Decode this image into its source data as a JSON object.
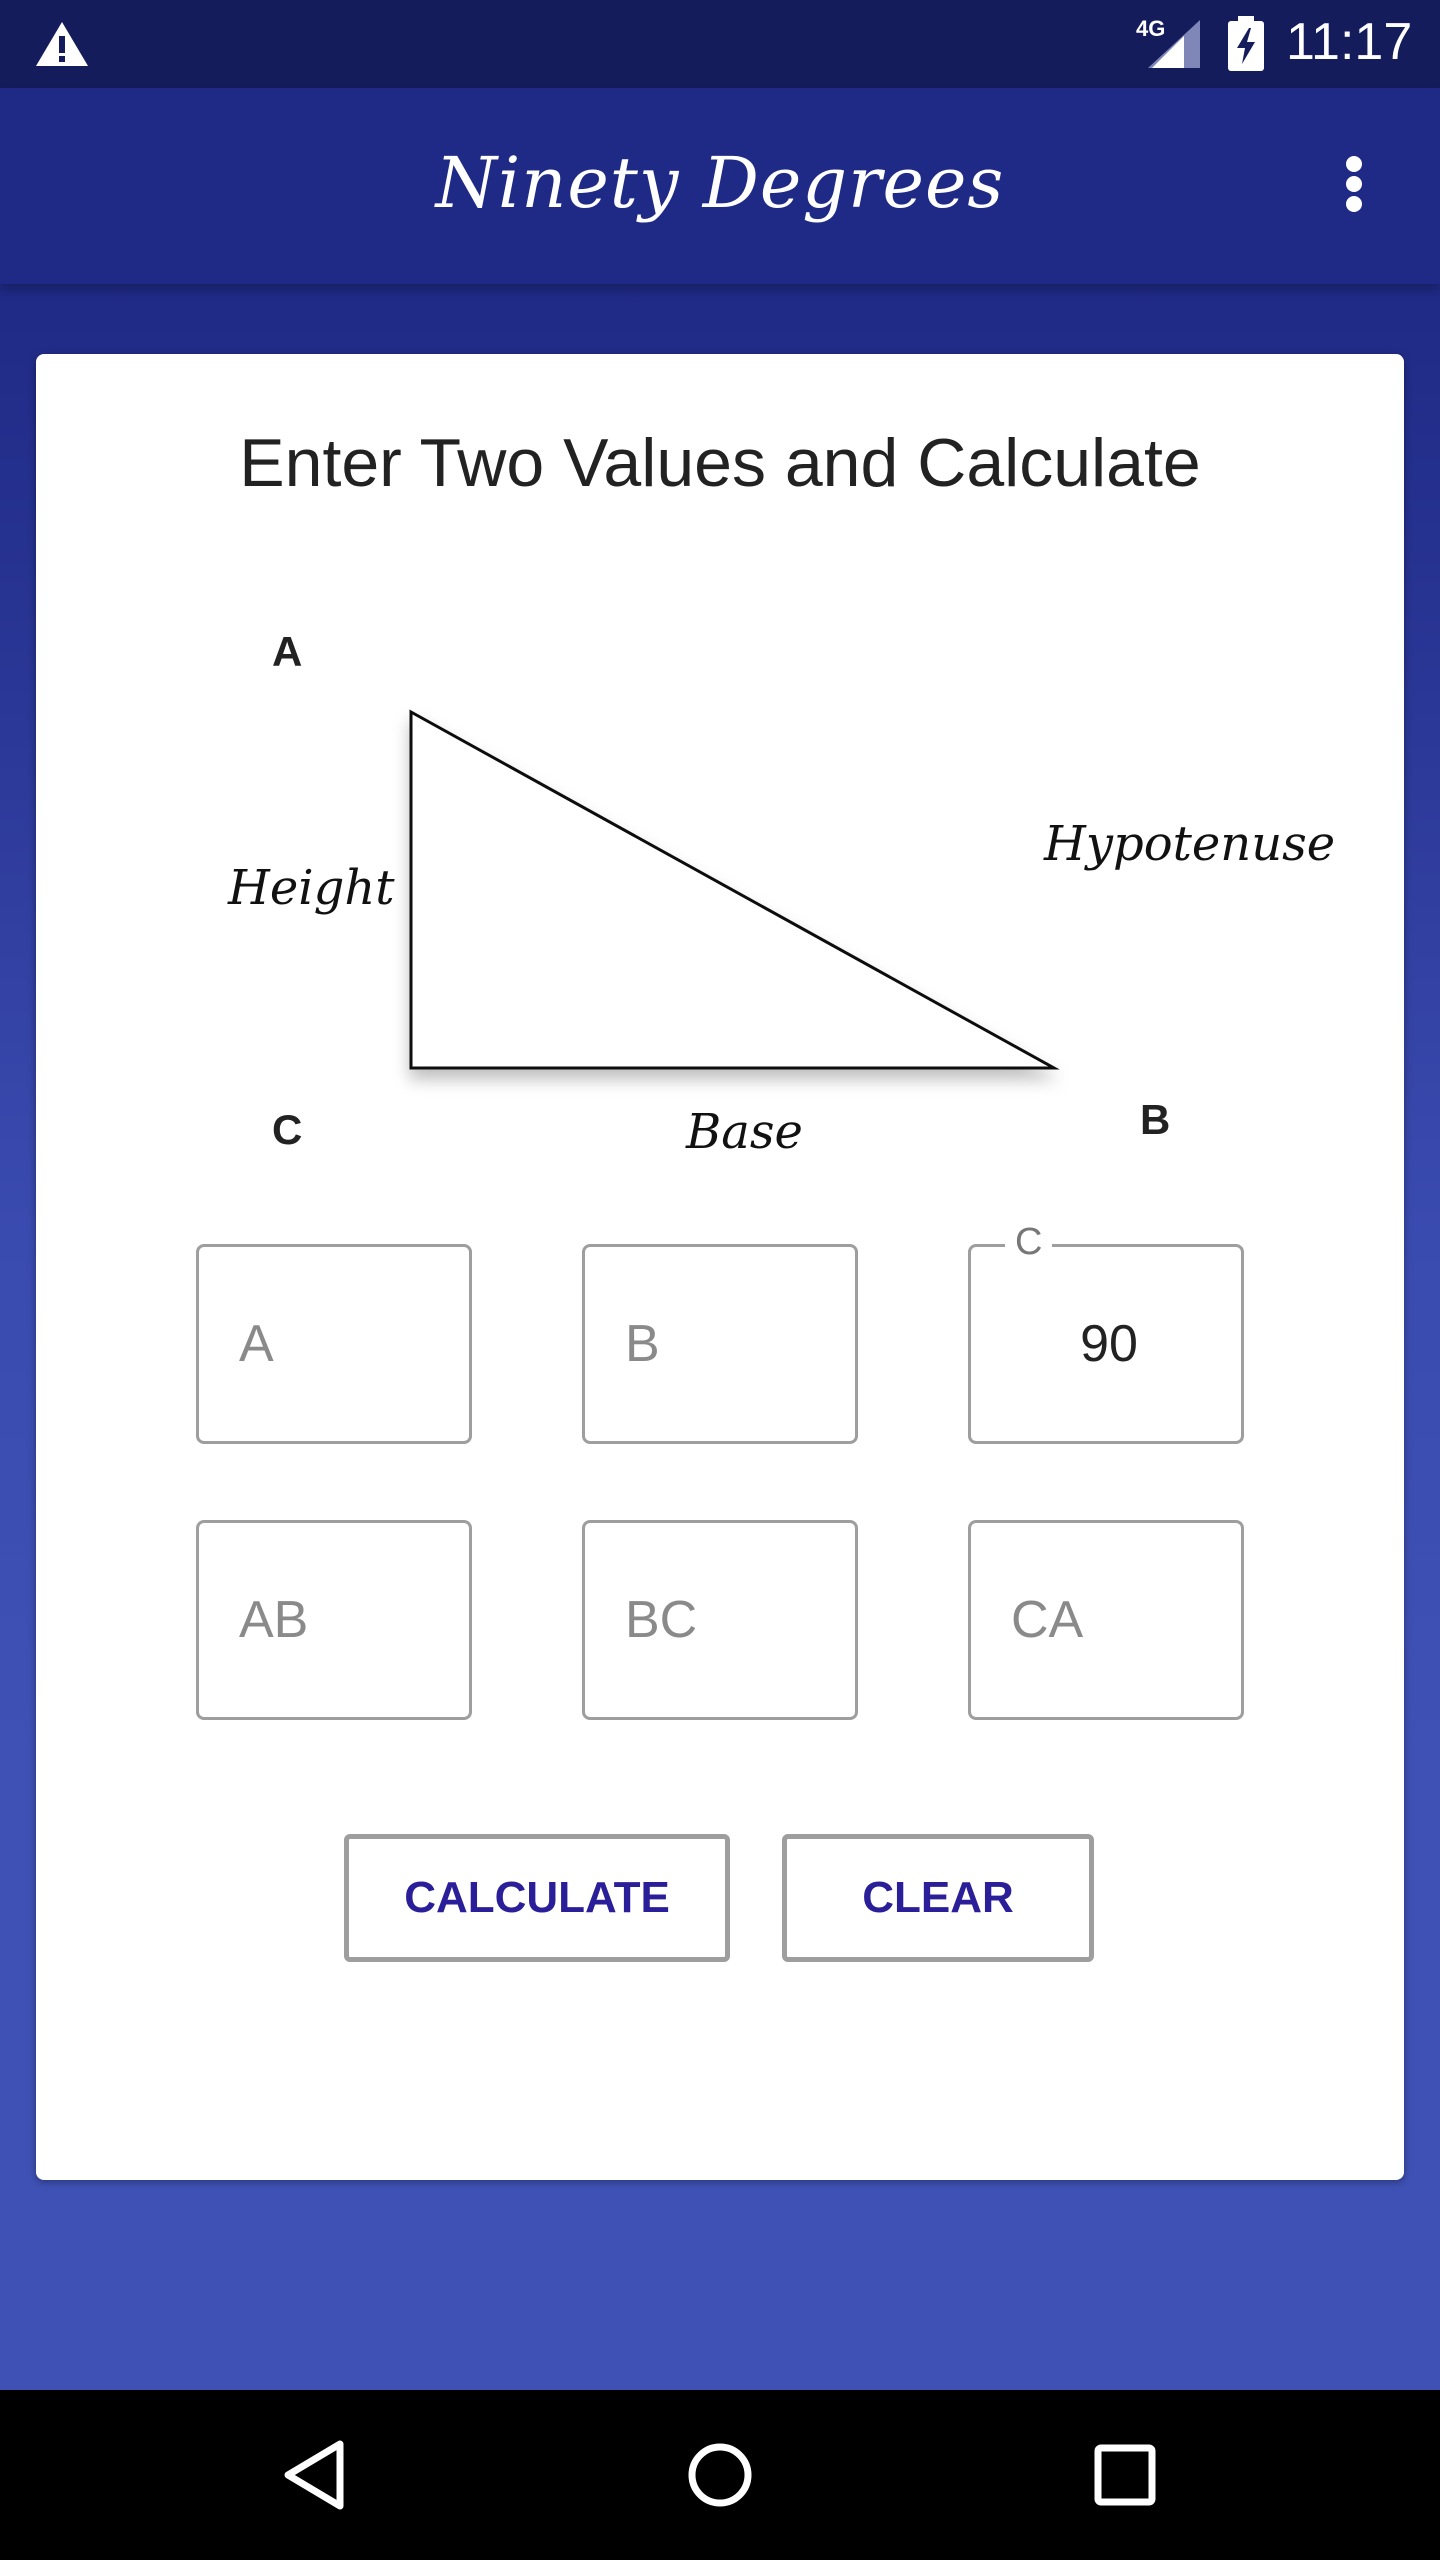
{
  "status_bar": {
    "network": "4G",
    "time": "11:17"
  },
  "app_bar": {
    "title": "Ninety Degrees"
  },
  "card": {
    "title": "Enter Two Values and Calculate",
    "diagram": {
      "corner_a": "A",
      "corner_b": "B",
      "corner_c": "C",
      "side_height": "Height",
      "side_base": "Base",
      "side_hypotenuse": "Hypotenuse"
    },
    "fields": {
      "a": {
        "placeholder": "A",
        "value": ""
      },
      "b": {
        "placeholder": "B",
        "value": ""
      },
      "c": {
        "label": "C",
        "value": "90"
      },
      "ab": {
        "placeholder": "AB",
        "value": ""
      },
      "bc": {
        "placeholder": "BC",
        "value": ""
      },
      "ca": {
        "placeholder": "CA",
        "value": ""
      }
    },
    "buttons": {
      "calculate": "CALCULATE",
      "clear": "CLEAR"
    }
  },
  "icons": {
    "status_warning": "warning-icon",
    "signal": "signal-icon",
    "battery": "battery-charging-icon",
    "overflow": "more-vert-icon",
    "nav_back": "back-icon",
    "nav_home": "home-icon",
    "nav_recents": "recents-icon"
  },
  "colors": {
    "status_bar": "#141c5b",
    "app_bar": "#1f2a86",
    "background": "#3f51b5",
    "button_text": "#2a1f99"
  }
}
